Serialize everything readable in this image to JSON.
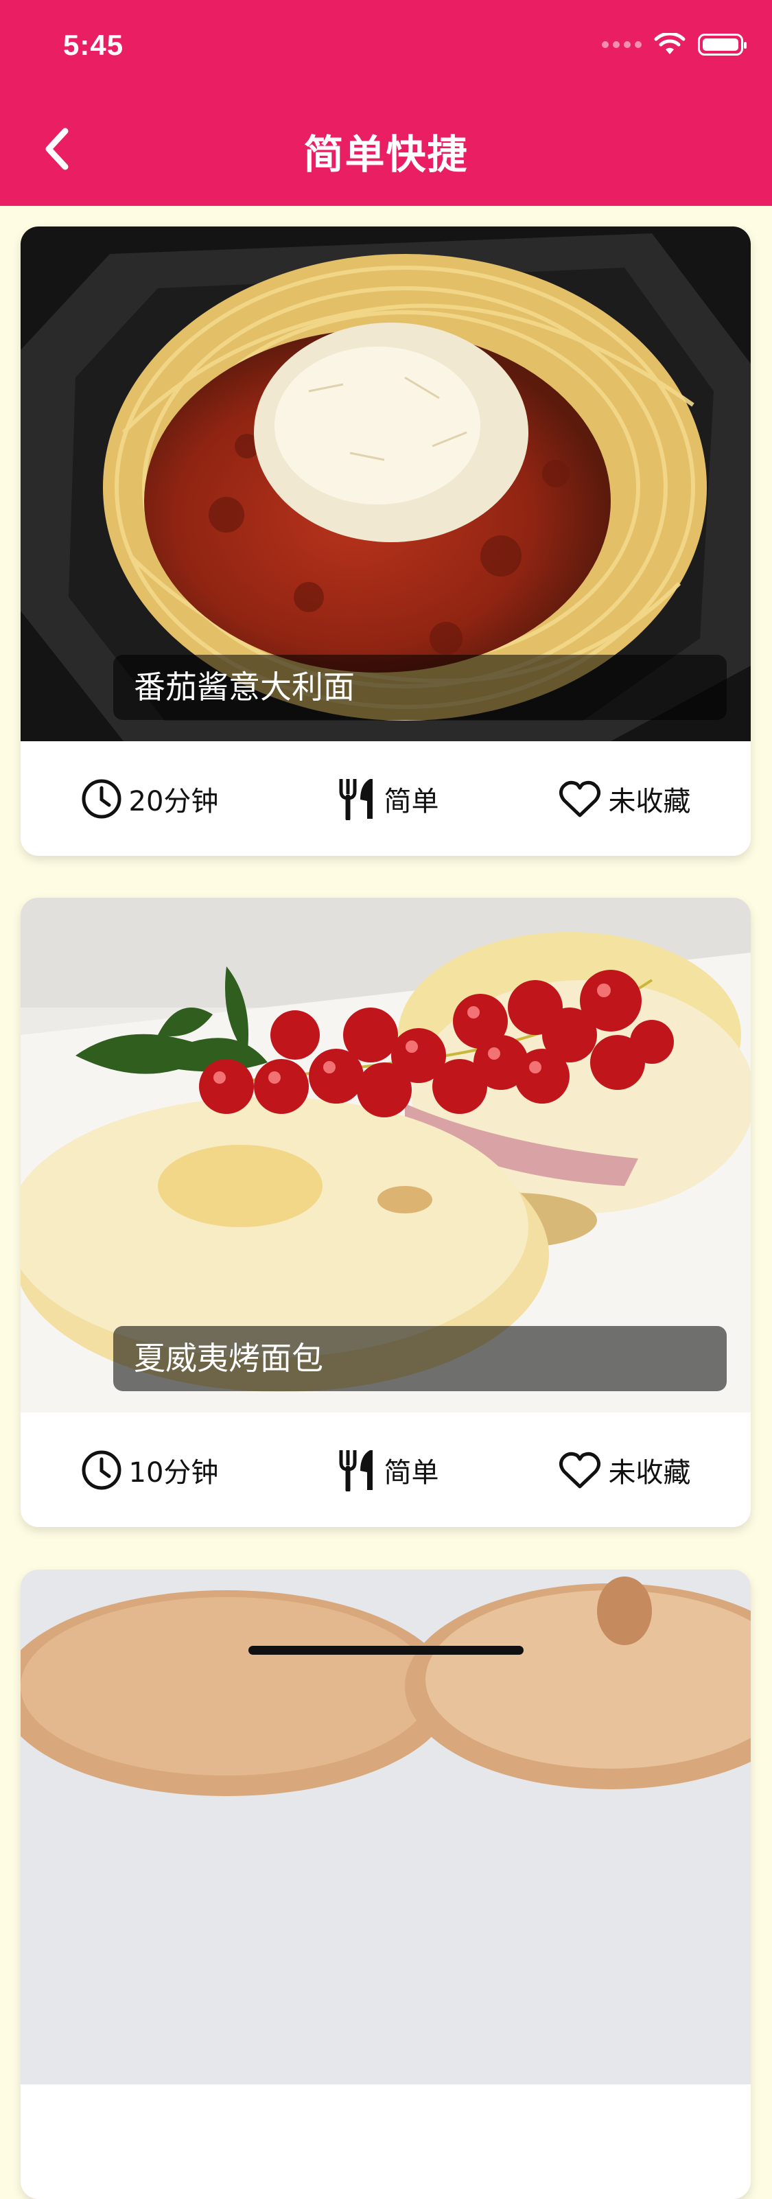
{
  "status_bar": {
    "time": "5:45"
  },
  "header": {
    "title": "简单快捷",
    "back_icon": "chevron-left-icon"
  },
  "colors": {
    "primary": "#E91E63",
    "background": "#FEFCE3"
  },
  "recipes": [
    {
      "title": "番茄酱意大利面",
      "duration": "20分钟",
      "difficulty": "简单",
      "favorite": "未收藏"
    },
    {
      "title": "夏威夷烤面包",
      "duration": "10分钟",
      "difficulty": "简单",
      "favorite": "未收藏"
    }
  ]
}
